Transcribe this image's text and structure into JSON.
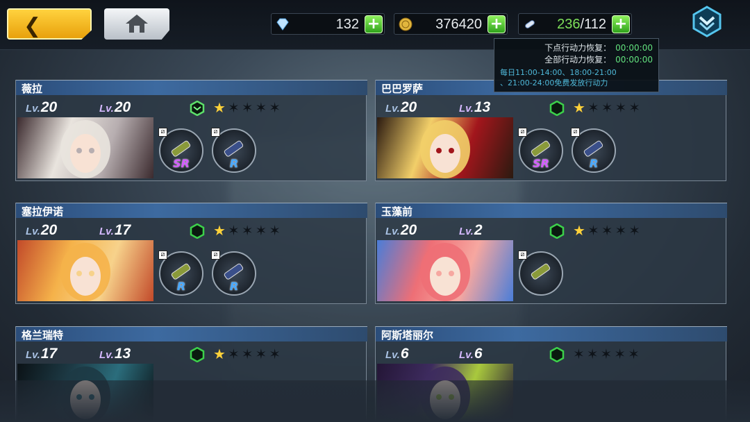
{
  "resources": {
    "gems": "132",
    "gold": "376420",
    "stamina_current": "236",
    "stamina_max": "/112"
  },
  "tooltip": {
    "next_label": "下点行动力恢复：",
    "next_time": "00:00:00",
    "full_label": "全部行动力恢复：",
    "full_time": "00:00:00",
    "note_line1": "每日11:00-14:00、18:00-21:00",
    "note_line2": "、21:00-24:00免费发放行动力"
  },
  "characters": [
    {
      "name": "薇拉",
      "lv1": "20",
      "lv2": "20",
      "stars": 1,
      "hex_color": "#5de06a",
      "slots": [
        {
          "rarity": "SR"
        },
        {
          "rarity": "R"
        }
      ]
    },
    {
      "name": "巴巴罗萨",
      "lv1": "20",
      "lv2": "13",
      "stars": 1,
      "hex_color": "#3cd04a",
      "slots": [
        {
          "rarity": "SR"
        },
        {
          "rarity": "R"
        }
      ]
    },
    {
      "name": "塞拉伊诺",
      "lv1": "20",
      "lv2": "17",
      "stars": 1,
      "hex_color": "#3cd04a",
      "slots": [
        {
          "rarity": "R"
        },
        {
          "rarity": "R"
        }
      ]
    },
    {
      "name": "玉藻前",
      "lv1": "20",
      "lv2": "2",
      "stars": 1,
      "hex_color": "#3cd04a",
      "slots": [
        {
          "rarity": ""
        }
      ]
    },
    {
      "name": "格兰瑞特",
      "lv1": "17",
      "lv2": "13",
      "stars": 1,
      "hex_color": "#3cd04a",
      "slots": []
    },
    {
      "name": "阿斯塔丽尔",
      "lv1": "6",
      "lv2": "6",
      "stars": 0,
      "hex_color": "#3cd04a",
      "slots": []
    }
  ],
  "labels": {
    "lv": "Lv.",
    "star_on": "★",
    "star_off": "✶"
  }
}
